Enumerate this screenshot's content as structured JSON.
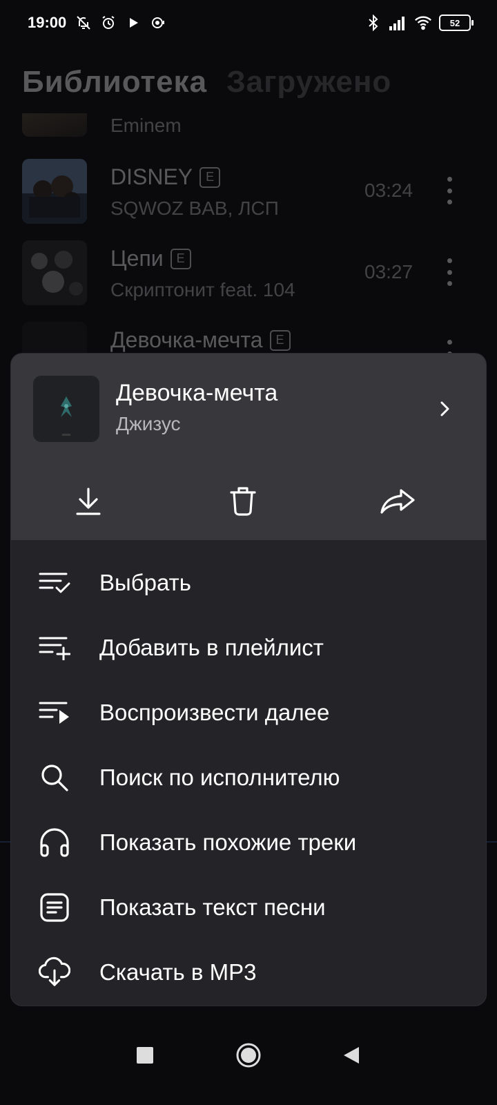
{
  "status_bar": {
    "time": "19:00",
    "left_icons": [
      "bell-off-icon",
      "alarm-icon",
      "play-icon",
      "podcast-icon"
    ],
    "right_icons": [
      "bluetooth-icon",
      "signal-icon",
      "wifi-icon"
    ],
    "battery": "52"
  },
  "background": {
    "tabs": [
      {
        "label": "Библиотека",
        "active": true
      },
      {
        "label": "Загружено",
        "active": false
      }
    ],
    "tracks": [
      {
        "title": "",
        "artist": "Eminem",
        "explicit": false,
        "duration": ""
      },
      {
        "title": "DISNEY",
        "artist": "SQWOZ BAB, ЛСП",
        "explicit": true,
        "explicit_badge": "E",
        "duration": "03:24"
      },
      {
        "title": "Цепи",
        "artist": "Скриптонит feat. 104",
        "explicit": true,
        "explicit_badge": "E",
        "duration": "03:27"
      },
      {
        "title": "Девочка-мечта",
        "artist": "",
        "explicit": true,
        "explicit_badge": "E",
        "duration": ""
      }
    ]
  },
  "sheet": {
    "track_title": "Девочка-мечта",
    "track_artist": "Джизус",
    "actions": [
      "download-icon",
      "delete-icon",
      "share-icon"
    ],
    "menu": [
      {
        "label": "Выбрать",
        "icon": "select-list-icon"
      },
      {
        "label": "Добавить в плейлист",
        "icon": "playlist-add-icon"
      },
      {
        "label": "Воспроизвести далее",
        "icon": "play-next-icon"
      },
      {
        "label": "Поиск по исполнителю",
        "icon": "search-icon"
      },
      {
        "label": "Показать похожие треки",
        "icon": "headphones-icon"
      },
      {
        "label": "Показать текст песни",
        "icon": "lyrics-icon"
      },
      {
        "label": "Скачать в MP3",
        "icon": "cloud-download-icon"
      }
    ]
  },
  "nav_bar": {
    "buttons": [
      "recents-icon",
      "home-icon",
      "back-icon"
    ]
  },
  "colors": {
    "sheet_header_bg": "#38373c",
    "sheet_body_bg": "#242327",
    "screen_bg": "#0a090c"
  }
}
